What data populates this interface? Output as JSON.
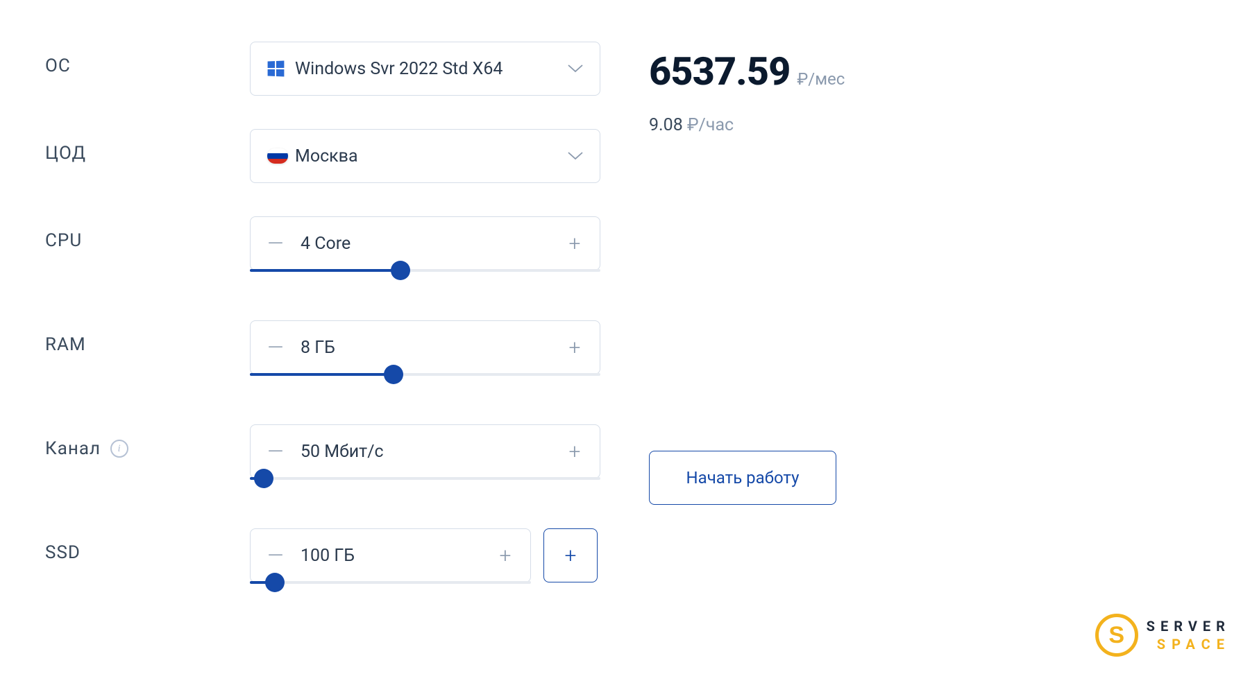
{
  "labels": {
    "os": "ОС",
    "datacenter": "ЦОД",
    "cpu": "CPU",
    "ram": "RAM",
    "channel": "Канал",
    "ssd": "SSD"
  },
  "os": {
    "value": "Windows Svr 2022 Std X64"
  },
  "datacenter": {
    "value": "Москва"
  },
  "cpu": {
    "value": "4 Core",
    "slider_percent": 43
  },
  "ram": {
    "value": "8 ГБ",
    "slider_percent": 41
  },
  "channel": {
    "value": "50 Мбит/с",
    "slider_percent": 4
  },
  "ssd": {
    "value": "100 ГБ",
    "slider_percent": 9
  },
  "pricing": {
    "monthly_value": "6537.59",
    "monthly_unit": "₽/мес",
    "hourly_value": "9.08",
    "hourly_unit": "₽/час"
  },
  "actions": {
    "start": "Начать работу"
  },
  "brand": {
    "line1": "SERVER",
    "line2": "SPACE"
  }
}
